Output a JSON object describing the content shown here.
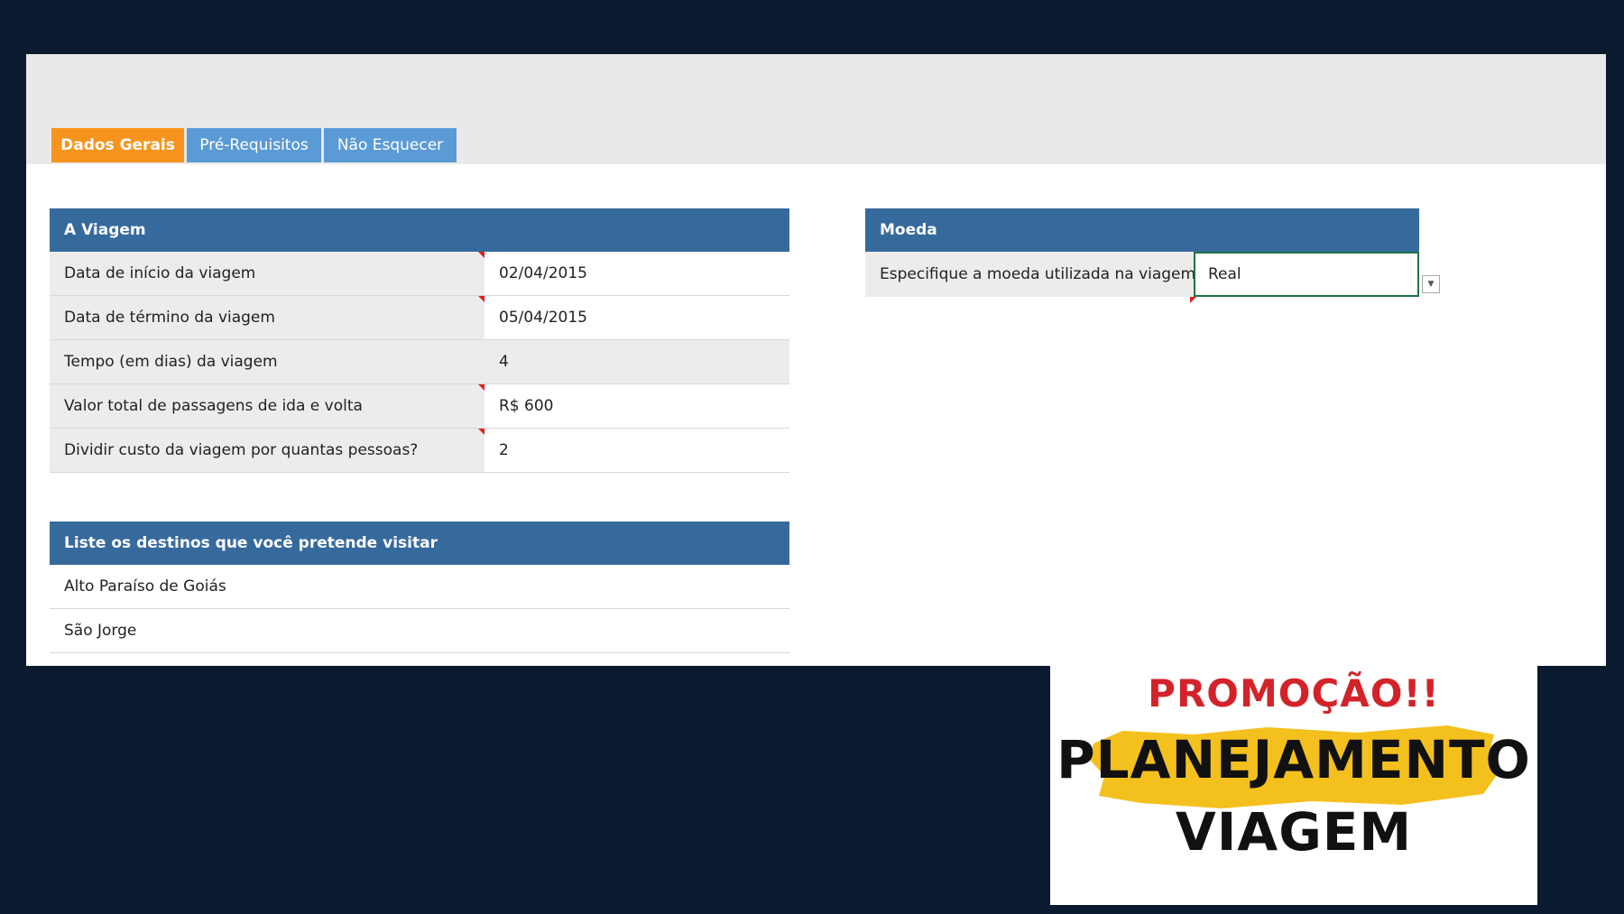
{
  "tabs": [
    {
      "label": "Dados Gerais",
      "active": true
    },
    {
      "label": "Pré-Requisitos",
      "active": false
    },
    {
      "label": "Não Esquecer",
      "active": false
    }
  ],
  "viagem": {
    "title": "A Viagem",
    "rows": [
      {
        "label": "Data de início da viagem",
        "value": "02/04/2015"
      },
      {
        "label": "Data de término da viagem",
        "value": "05/04/2015"
      },
      {
        "label": "Tempo (em dias) da viagem",
        "value": "4"
      },
      {
        "label": "Valor total de passagens de ida e volta",
        "value": "R$ 600"
      },
      {
        "label": "Dividir custo da viagem por quantas pessoas?",
        "value": "2"
      }
    ]
  },
  "moeda": {
    "title": "Moeda",
    "label": "Especifique a moeda utilizada na viagem",
    "value": "Real",
    "dropdown_icon": "chevron-down-icon"
  },
  "destinos": {
    "title": "Liste os destinos que você pretende visitar",
    "items": [
      "Alto Paraíso de Goiás",
      "São Jorge"
    ]
  },
  "promo": {
    "line1": "PROMOÇÃO!!",
    "line2": "PLANEJAMENTO",
    "line3": "VIAGEM"
  },
  "colors": {
    "tab_active": "#f7941d",
    "tab_inactive": "#5b9bd5",
    "header": "#366a9d",
    "promo_red": "#d3232a",
    "promo_yellow": "#f4c01e"
  }
}
